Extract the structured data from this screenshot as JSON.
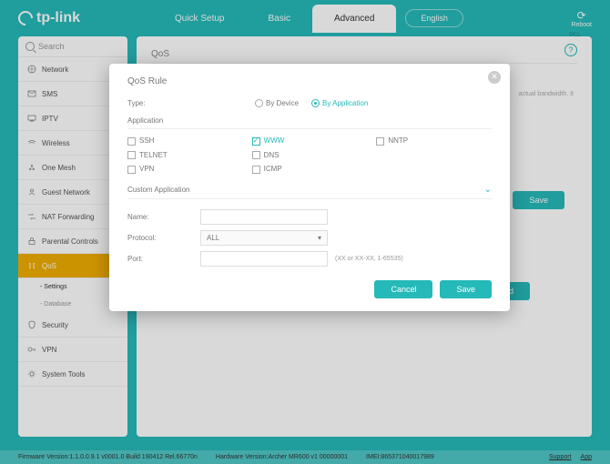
{
  "brand": "tp-link",
  "tabs": {
    "quick": "Quick Setup",
    "basic": "Basic",
    "advanced": "Advanced"
  },
  "language": "English",
  "reboot": "Reboot",
  "search_placeholder": "Search",
  "nav": {
    "network": "Network",
    "sms": "SMS",
    "iptv": "IPTV",
    "wireless": "Wireless",
    "onemesh": "One Mesh",
    "guest": "Guest Network",
    "nat": "NAT Forwarding",
    "parental": "Parental Controls",
    "qos": "QoS",
    "security": "Security",
    "vpn": "VPN",
    "tools": "System Tools",
    "sub_settings": "- Settings",
    "sub_database": "- Database"
  },
  "page": {
    "title": "QoS",
    "save": "Save",
    "add": "Add",
    "hint_tail": "actual bandwidth. It"
  },
  "modal": {
    "title": "QoS Rule",
    "type_label": "Type:",
    "by_device": "By Device",
    "by_app": "By Application",
    "app_section": "Application",
    "apps": {
      "ssh": "SSH",
      "www": "WWW",
      "nntp": "NNTP",
      "telnet": "TELNET",
      "dns": "DNS",
      "vpn": "VPN",
      "icmp": "ICMP"
    },
    "custom": "Custom Application",
    "name": "Name:",
    "protocol": "Protocol:",
    "protocol_value": "ALL",
    "port": "Port:",
    "port_hint": "(XX or XX-XX, 1-65535)",
    "cancel": "Cancel",
    "save": "Save"
  },
  "footer": {
    "fw": "Firmware Version:1.1.0.0.9.1 v0001.0 Build 190412 Rel.66770n",
    "hw": "Hardware Version:Archer MR600 v1 00000001",
    "imei": "IMEI:865371040017989",
    "support": "Support",
    "app": "App"
  }
}
